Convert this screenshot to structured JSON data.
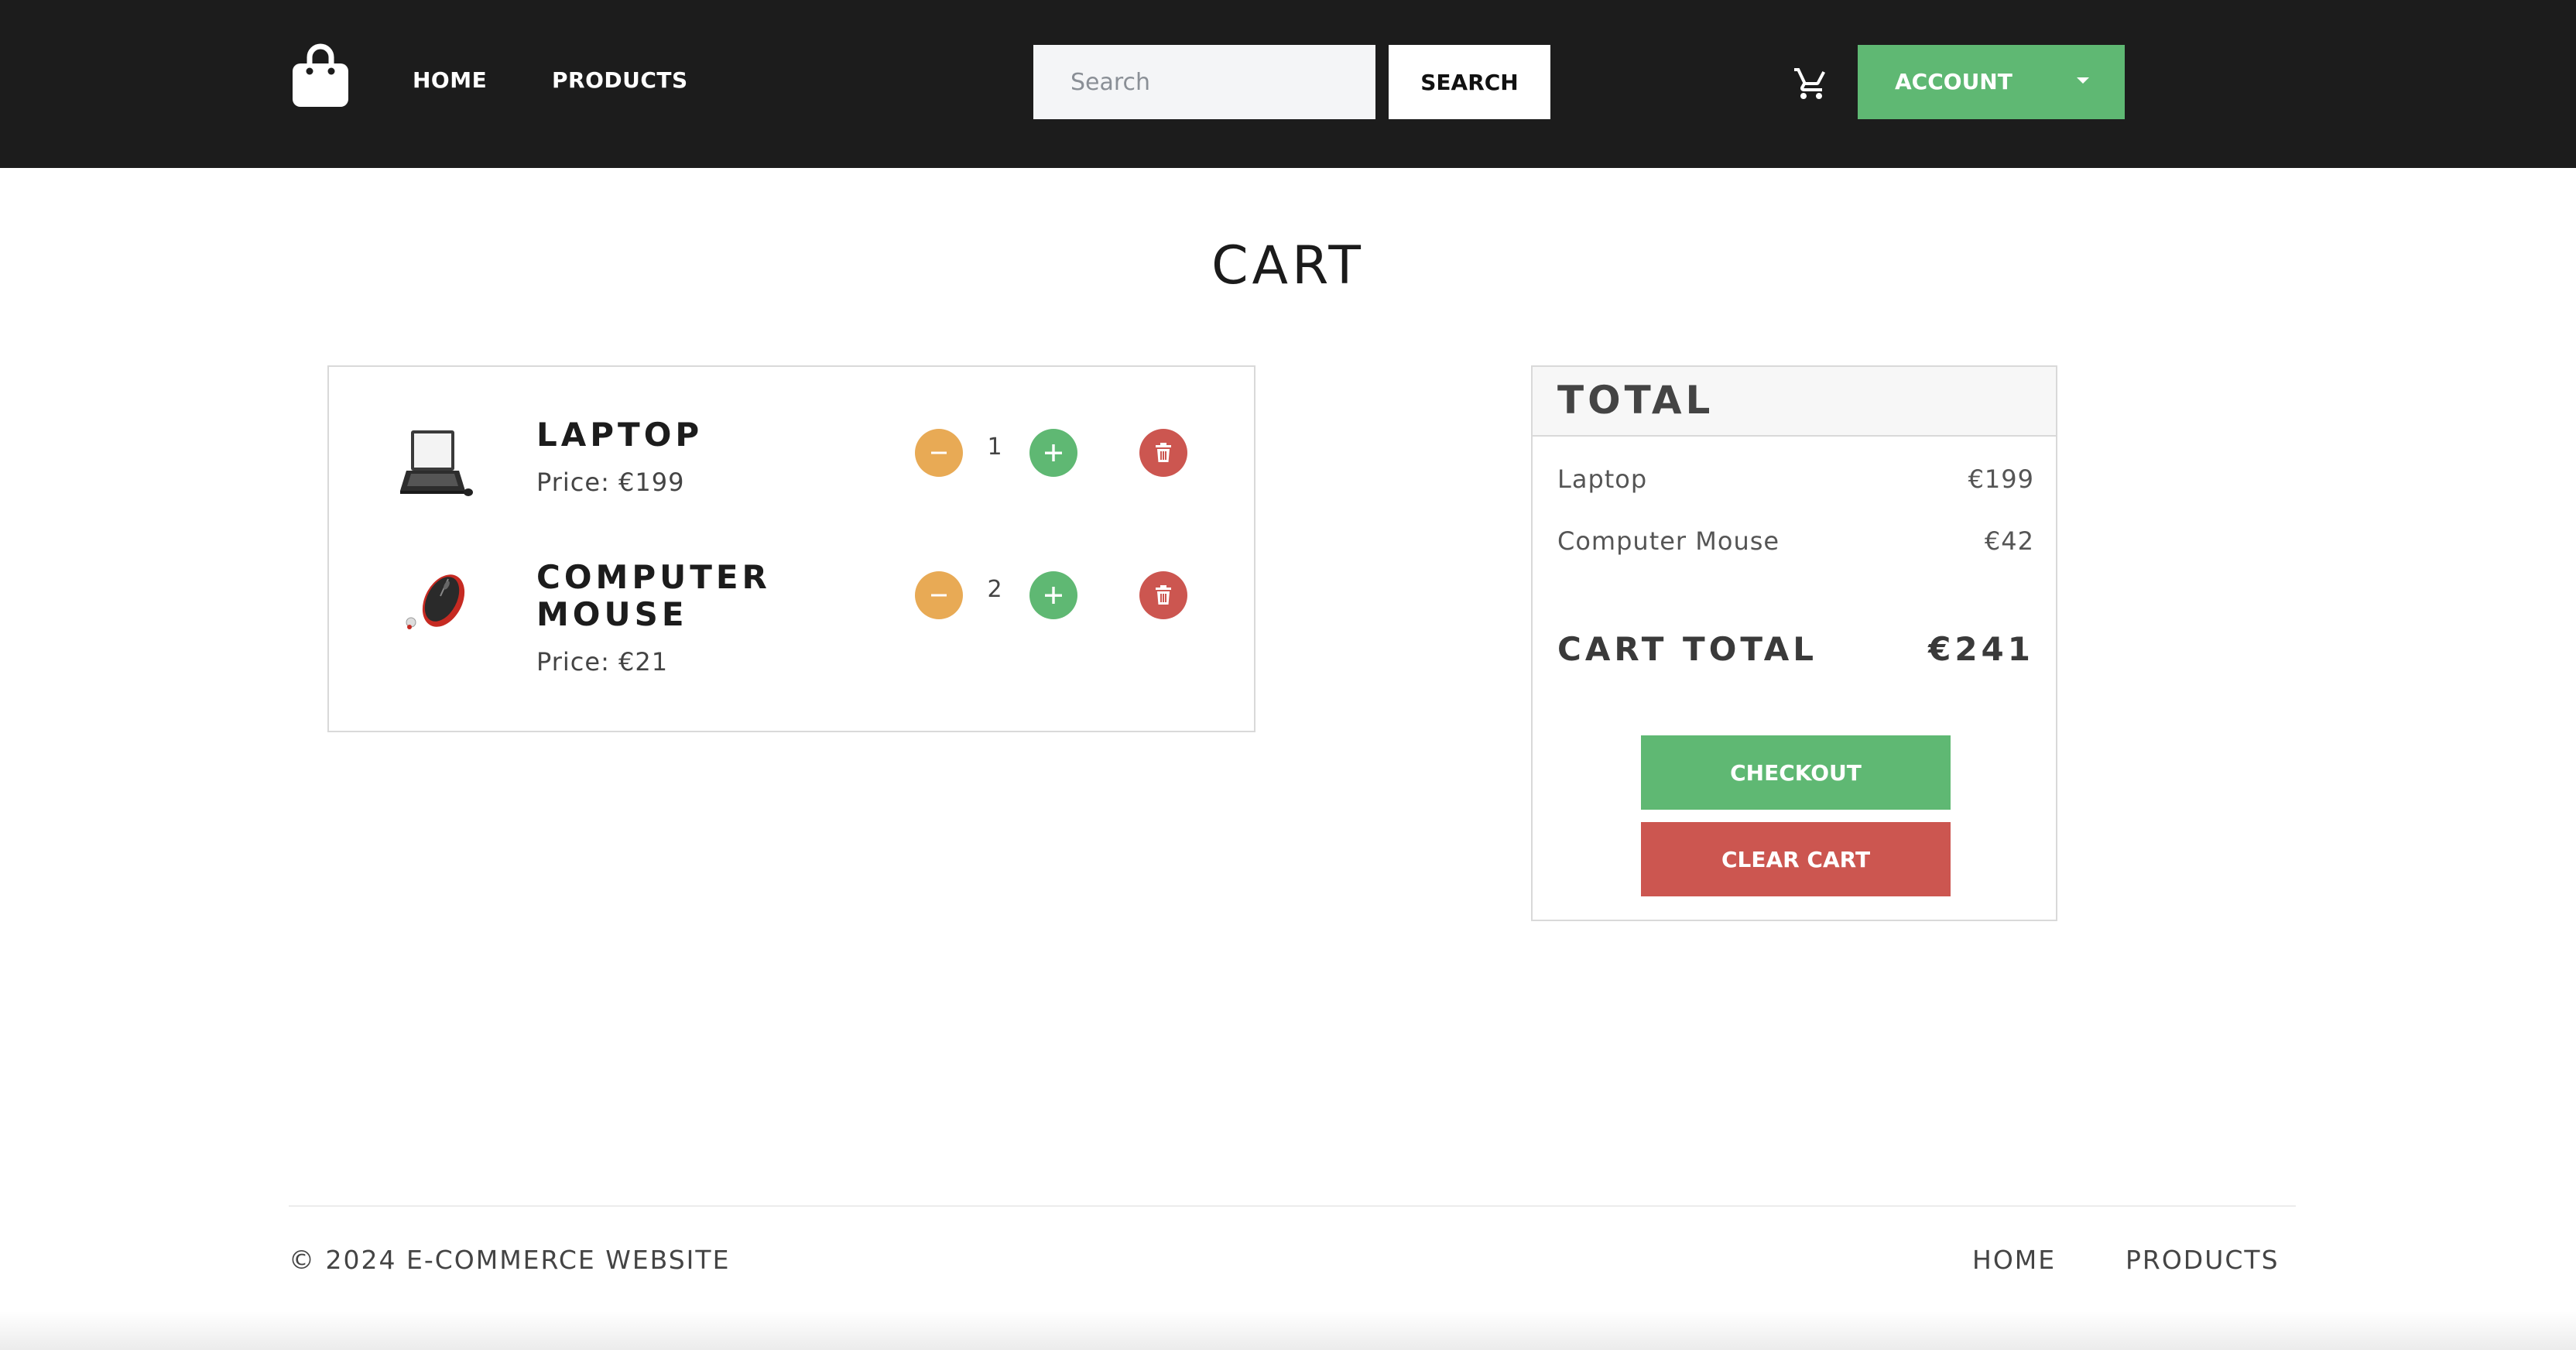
{
  "header": {
    "logo_icon": "shopping-bag-icon",
    "nav": [
      {
        "label": "HOME"
      },
      {
        "label": "PRODUCTS"
      }
    ],
    "search": {
      "placeholder": "Search",
      "value": "",
      "button_label": "SEARCH"
    },
    "cart_icon": "shopping-cart-icon",
    "account": {
      "label": "ACCOUNT",
      "icon": "caret-down-icon",
      "color": "#5fb873"
    }
  },
  "page": {
    "title": "CART"
  },
  "cart": {
    "items": [
      {
        "name": "LAPTOP",
        "price": "Price: €199",
        "quantity": "1",
        "image": "laptop-image"
      },
      {
        "name": "COMPUTER MOUSE",
        "price": "Price: €21",
        "quantity": "2",
        "image": "computer-mouse-image"
      }
    ],
    "controls": {
      "decrease_icon": "minus-icon",
      "increase_icon": "plus-icon",
      "remove_icon": "trash-icon"
    }
  },
  "totals": {
    "title": "TOTAL",
    "lines": [
      {
        "name": "Laptop",
        "amount": "€199"
      },
      {
        "name": "Computer Mouse",
        "amount": "€42"
      }
    ],
    "grand_label": "CART TOTAL",
    "grand_value": "€241",
    "checkout_label": "CHECKOUT",
    "clear_label": "CLEAR CART"
  },
  "footer": {
    "copyright": "© 2024 E-COMMERCE WEBSITE",
    "links": [
      {
        "label": "HOME"
      },
      {
        "label": "PRODUCTS"
      }
    ]
  },
  "colors": {
    "header_bg": "#1c1c1c",
    "success": "#5fb873",
    "warning": "#e8aa55",
    "danger": "#cc5650"
  }
}
